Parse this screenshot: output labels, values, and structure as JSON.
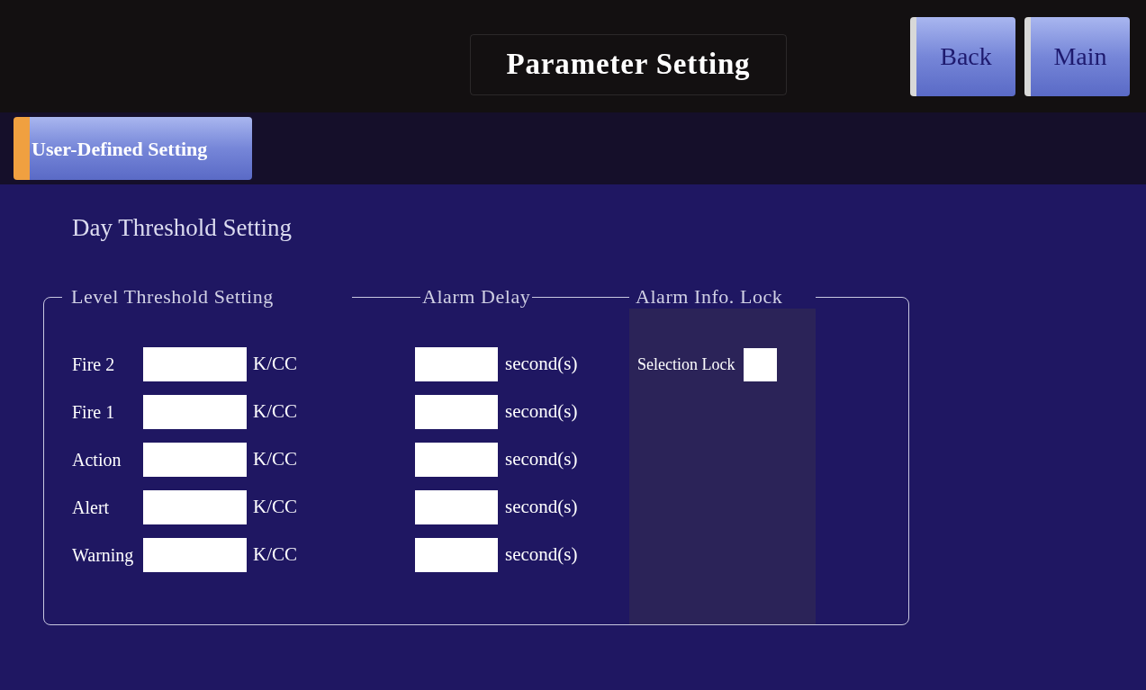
{
  "window": {
    "title": "Parameter Setting"
  },
  "nav_buttons": [
    {
      "label": "Back"
    },
    {
      "label": "Main"
    }
  ],
  "tabs": [
    {
      "label": "User-Defined Setting",
      "selected": true
    }
  ],
  "section_title": "Day Threshold Setting",
  "panel": {
    "headers": [
      "Level Threshold Setting",
      "Alarm Delay",
      "Alarm Info. Lock"
    ],
    "rows": [
      {
        "label": "Fire 2",
        "unit": "K/CC",
        "delay_unit": "second(s)"
      },
      {
        "label": "Fire 1",
        "unit": "K/CC",
        "delay_unit": "second(s)"
      },
      {
        "label": "Action",
        "unit": "K/CC",
        "delay_unit": "second(s)"
      },
      {
        "label": "Alert",
        "unit": "K/CC",
        "delay_unit": "second(s)"
      },
      {
        "label": "Warning",
        "unit": "K/CC",
        "delay_unit": "second(s)"
      }
    ],
    "lock": {
      "label": "Selection Lock",
      "checked": false
    }
  }
}
